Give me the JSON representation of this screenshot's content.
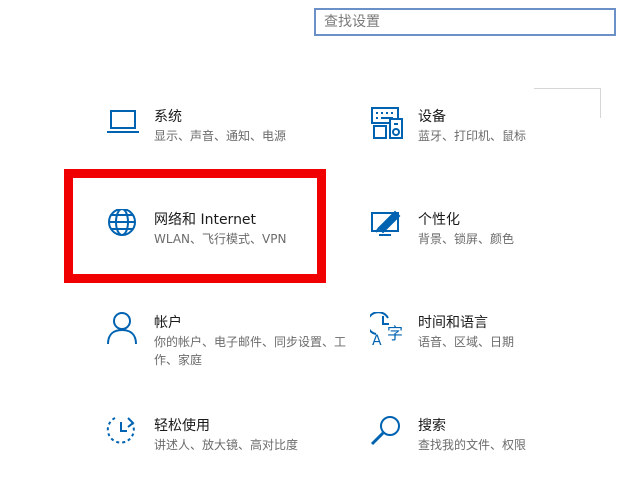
{
  "search": {
    "placeholder": "查找设置"
  },
  "tiles": [
    {
      "title": "系统",
      "desc": "显示、声音、通知、电源",
      "icon": "laptop-icon"
    },
    {
      "title": "设备",
      "desc": "蓝牙、打印机、鼠标",
      "icon": "keyboard-devices-icon"
    },
    {
      "title": "网络和 Internet",
      "desc": "WLAN、飞行模式、VPN",
      "icon": "globe-icon"
    },
    {
      "title": "个性化",
      "desc": "背景、锁屏、颜色",
      "icon": "paint-brush-icon"
    },
    {
      "title": "帐户",
      "desc": "你的帐户、电子邮件、同步设置、工作、家庭",
      "icon": "person-icon"
    },
    {
      "title": "时间和语言",
      "desc": "语音、区域、日期",
      "icon": "time-language-icon"
    },
    {
      "title": "轻松使用",
      "desc": "讲述人、放大镜、高对比度",
      "icon": "ease-of-access-icon"
    },
    {
      "title": "搜索",
      "desc": "查找我的文件、权限",
      "icon": "search-icon"
    }
  ],
  "colors": {
    "accent": "#0063b1",
    "highlight": "#f00000"
  }
}
